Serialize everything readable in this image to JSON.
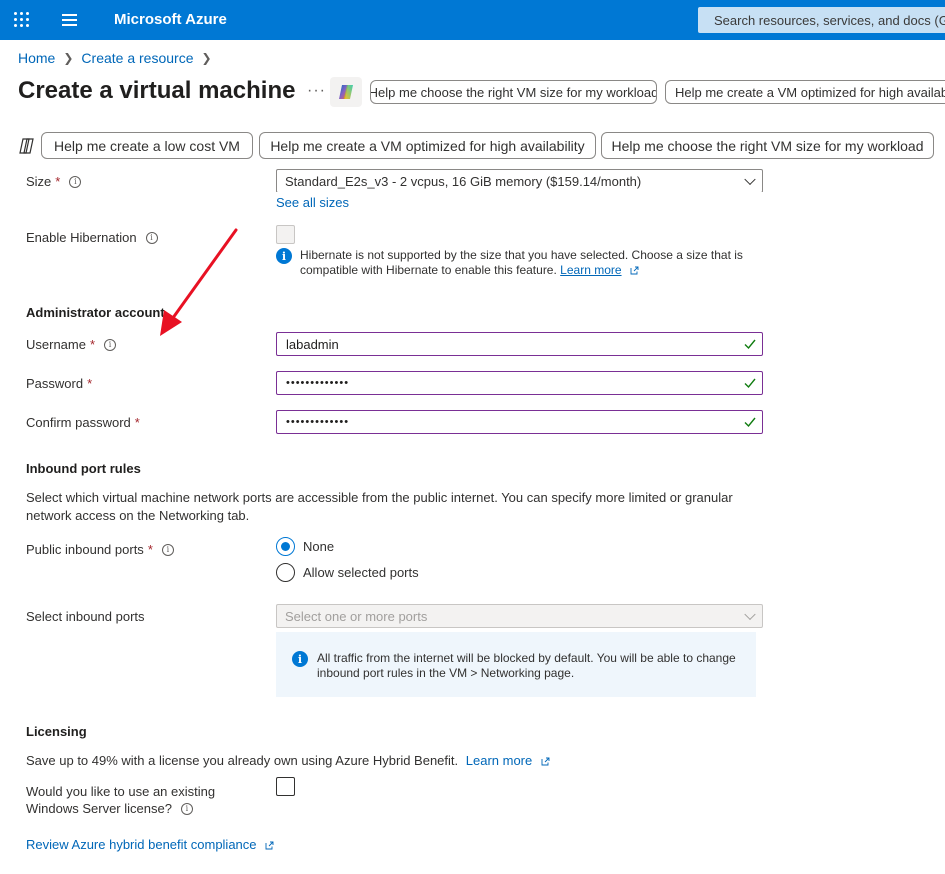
{
  "topbar": {
    "brand": "Microsoft Azure",
    "search_placeholder": "Search resources, services, and docs (G+/)"
  },
  "breadcrumb": [
    "Home",
    "Create a resource"
  ],
  "header": {
    "title": "Create a virtual machine",
    "more": "···",
    "top_actions": [
      "Help me choose the right VM size for my workload",
      "Help me create a VM optimized for high availability"
    ]
  },
  "copilot_prompts": [
    "Help me create a low cost VM",
    "Help me create a VM optimized for high availability",
    "Help me choose the right VM size for my workload"
  ],
  "size": {
    "label": "Size",
    "required": "*",
    "value": "Standard_E2s_v3 - 2 vcpus, 16 GiB memory ($159.14/month)",
    "see_all": "See all sizes"
  },
  "hibernation": {
    "label": "Enable Hibernation",
    "message": "Hibernate is not supported by the size that you have selected. Choose a size that is compatible with Hibernate to enable this feature.",
    "learn_more": "Learn more"
  },
  "admin": {
    "heading": "Administrator account",
    "username_label": "Username",
    "username_value": "labadmin",
    "password_label": "Password",
    "password_value": "•••••••••••••",
    "confirm_label": "Confirm password",
    "confirm_value": "•••••••••••••",
    "required": "*"
  },
  "inbound": {
    "heading": "Inbound port rules",
    "description": "Select which virtual machine network ports are accessible from the public internet. You can specify more limited or granular network access on the Networking tab.",
    "public_label": "Public inbound ports",
    "required": "*",
    "options": [
      "None",
      "Allow selected ports"
    ],
    "selected": "None",
    "select_label": "Select inbound ports",
    "select_placeholder": "Select one or more ports",
    "info": "All traffic from the internet will be blocked by default. You will be able to change inbound port rules in the VM > Networking page."
  },
  "licensing": {
    "heading": "Licensing",
    "description": "Save up to 49% with a license you already own using Azure Hybrid Benefit.",
    "learn_more": "Learn more",
    "question_line1": "Would you like to use an existing",
    "question_line2": "Windows Server license?",
    "review_link": "Review Azure hybrid benefit compliance"
  },
  "colors": {
    "azure_blue": "#0078d4",
    "link": "#0067b8",
    "required": "#a4262c",
    "valid_check": "#107c10",
    "annotation_arrow": "#e81123"
  }
}
